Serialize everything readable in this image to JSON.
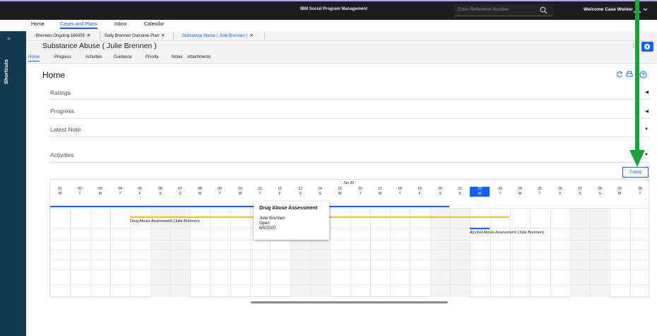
{
  "topbar": {
    "brand": "IBM Social Program Management",
    "search_placeholder": "Enter Reference Number",
    "welcome": "Welcome Case Worker"
  },
  "mainnav": {
    "items": [
      "Home",
      "Cases and Plans",
      "Inbox",
      "Calendar"
    ]
  },
  "shortcuts": {
    "label": "Shortcuts"
  },
  "tabs": [
    {
      "label": "Brennen Ongoing 166009"
    },
    {
      "label": "Sally Brennen Outcome Plan"
    },
    {
      "label": "Substance Abuse ( Julie Brennen )"
    }
  ],
  "case": {
    "title": "Substance Abuse ( Julie Brennen )"
  },
  "subnav": {
    "items": [
      "Home",
      "Progress",
      "Activities",
      "Guidance",
      "Priority",
      "Notes",
      "Attachments"
    ]
  },
  "page": {
    "title": "Home"
  },
  "sections": [
    "Ratings",
    "Progress",
    "Latest Note",
    "Activities"
  ],
  "calendar": {
    "today_label": "Today",
    "month": "Jun 20",
    "days": [
      {
        "n": "01",
        "d": "M"
      },
      {
        "n": "02",
        "d": "T"
      },
      {
        "n": "03",
        "d": "W"
      },
      {
        "n": "04",
        "d": "T"
      },
      {
        "n": "05",
        "d": "F"
      },
      {
        "n": "06",
        "d": "S"
      },
      {
        "n": "07",
        "d": "S"
      },
      {
        "n": "08",
        "d": "M"
      },
      {
        "n": "09",
        "d": "T"
      },
      {
        "n": "10",
        "d": "W"
      },
      {
        "n": "11",
        "d": "T"
      },
      {
        "n": "12",
        "d": "F"
      },
      {
        "n": "13",
        "d": "S"
      },
      {
        "n": "14",
        "d": "S"
      },
      {
        "n": "15",
        "d": "M"
      },
      {
        "n": "16",
        "d": "T"
      },
      {
        "n": "17",
        "d": "W"
      },
      {
        "n": "18",
        "d": "T"
      },
      {
        "n": "19",
        "d": "F"
      },
      {
        "n": "20",
        "d": "S"
      },
      {
        "n": "21",
        "d": "S"
      },
      {
        "n": "22",
        "d": "M"
      },
      {
        "n": "23",
        "d": "T"
      },
      {
        "n": "24",
        "d": "W"
      },
      {
        "n": "25",
        "d": "T"
      },
      {
        "n": "26",
        "d": "F"
      },
      {
        "n": "27",
        "d": "S"
      },
      {
        "n": "28",
        "d": "S"
      },
      {
        "n": "29",
        "d": "M"
      },
      {
        "n": "30",
        "d": "T"
      }
    ],
    "today_day": "22",
    "events": [
      {
        "label": "Drug Abuse Assessment (Julie Brennen)"
      },
      {
        "label": "Alcohol Abuse Assessment (Julie Brennen)"
      }
    ],
    "popup": {
      "title": "Drug Abuse Assessment",
      "lines": [
        "Julie Brennen",
        "Open",
        "6/5/2020"
      ]
    }
  },
  "colors": {
    "accent": "#0f62fe",
    "event_bar": "#f1c21b",
    "sidebar": "#11394f",
    "annotation_arrow": "#1aa23c"
  }
}
